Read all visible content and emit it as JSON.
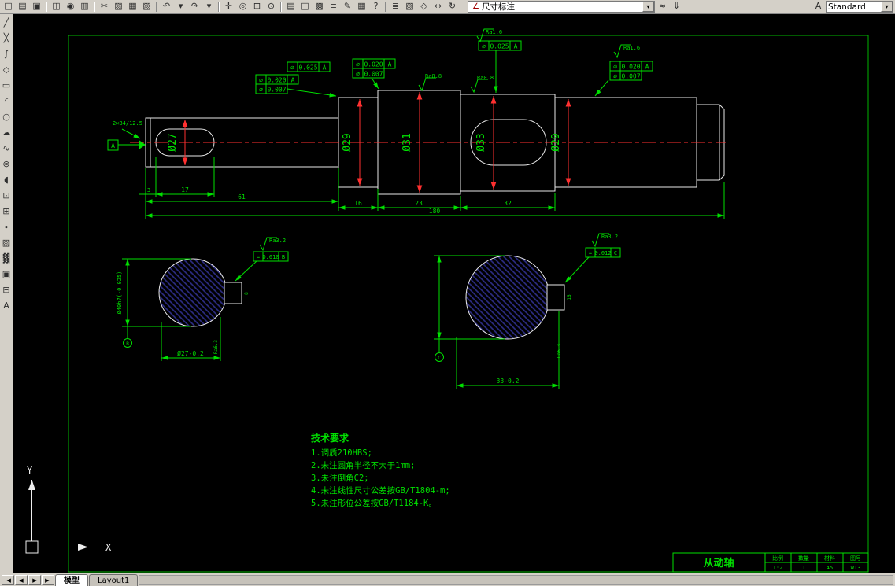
{
  "app": {
    "top_toolbar": {
      "icons": [
        {
          "name": "new-file",
          "glyph": "□"
        },
        {
          "name": "open-file",
          "glyph": "▤"
        },
        {
          "name": "save",
          "glyph": "▣"
        },
        {
          "sep": true
        },
        {
          "name": "plot",
          "glyph": "◫"
        },
        {
          "name": "plot-preview",
          "glyph": "◉"
        },
        {
          "name": "publish",
          "glyph": "▥"
        },
        {
          "sep": true
        },
        {
          "name": "cut",
          "glyph": "✂"
        },
        {
          "name": "copy",
          "glyph": "▧"
        },
        {
          "name": "paste",
          "glyph": "▦"
        },
        {
          "name": "match-properties",
          "glyph": "▨"
        },
        {
          "sep": true
        },
        {
          "name": "undo",
          "glyph": "↶"
        },
        {
          "name": "undo-dropdown",
          "glyph": "▾"
        },
        {
          "name": "redo",
          "glyph": "↷"
        },
        {
          "name": "redo-dropdown",
          "glyph": "▾"
        },
        {
          "sep": true
        },
        {
          "name": "pan",
          "glyph": "✛"
        },
        {
          "name": "zoom-realtime",
          "glyph": "◎"
        },
        {
          "name": "zoom-window",
          "glyph": "⊡"
        },
        {
          "name": "zoom-previous",
          "glyph": "⊙"
        },
        {
          "sep": true
        },
        {
          "name": "properties",
          "glyph": "▤"
        },
        {
          "name": "designcenter",
          "glyph": "◫"
        },
        {
          "name": "tool-palettes",
          "glyph": "▩"
        },
        {
          "name": "sheet-set-manager",
          "glyph": "≡"
        },
        {
          "name": "markup-set-manager",
          "glyph": "✎"
        },
        {
          "name": "quickcalc",
          "glyph": "▦"
        },
        {
          "name": "help",
          "glyph": "?"
        },
        {
          "sep": true
        },
        {
          "name": "layer-properties",
          "glyph": "≣"
        },
        {
          "name": "layer-control",
          "glyph": "▧"
        },
        {
          "name": "object-snap",
          "glyph": "◇"
        },
        {
          "name": "distance",
          "glyph": "↔"
        },
        {
          "name": "redraw",
          "glyph": "↻"
        }
      ],
      "dim_combo_icon": "∠",
      "dim_combo_value": "尺寸标注",
      "extra_icons": [
        {
          "name": "dim-update",
          "glyph": "≈"
        },
        {
          "name": "dim-reassociate",
          "glyph": "⇓"
        }
      ],
      "text_style_icon": "A",
      "style_combo_value": "Standard",
      "dropdown_glyph": "▾"
    },
    "left_toolbar": {
      "icons": [
        {
          "name": "line",
          "glyph": "╱"
        },
        {
          "name": "construction-line",
          "glyph": "╳"
        },
        {
          "name": "polyline",
          "glyph": "∫"
        },
        {
          "name": "polygon",
          "glyph": "◇"
        },
        {
          "name": "rectangle",
          "glyph": "▭"
        },
        {
          "name": "arc",
          "glyph": "◜"
        },
        {
          "name": "circle",
          "glyph": "○"
        },
        {
          "name": "revision-cloud",
          "glyph": "☁"
        },
        {
          "name": "spline",
          "glyph": "∿"
        },
        {
          "name": "ellipse",
          "glyph": "⊜"
        },
        {
          "name": "ellipse-arc",
          "glyph": "◖"
        },
        {
          "name": "insert-block",
          "glyph": "⊡"
        },
        {
          "name": "make-block",
          "glyph": "⊞"
        },
        {
          "name": "point",
          "glyph": "∙"
        },
        {
          "name": "hatch",
          "glyph": "▨"
        },
        {
          "name": "gradient",
          "glyph": "▓"
        },
        {
          "name": "region",
          "glyph": "▣"
        },
        {
          "name": "table",
          "glyph": "⊟"
        },
        {
          "name": "multiline-text",
          "glyph": "A"
        }
      ]
    },
    "tab_bar": {
      "nav": [
        "|◀",
        "◀",
        "▶",
        "▶|"
      ],
      "tabs": [
        {
          "label": "模型",
          "active": true
        },
        {
          "label": "Layout1",
          "active": false
        }
      ]
    }
  },
  "drawing": {
    "diameters": {
      "d1": "Ø27",
      "d2": "Ø29",
      "d3": "Ø31",
      "d4": "Ø33",
      "d5": "Ø29"
    },
    "lengths": {
      "l1": "3",
      "l2": "17",
      "l3": "61",
      "l4": "16",
      "l5": "23",
      "l6": "32",
      "l7": "180"
    },
    "center_hole_note": "2×B4/12.5",
    "datums": {
      "a": "A",
      "b": "B",
      "c": "C"
    },
    "roughness": {
      "r1": "Ra0.8",
      "r2": "Ra0.8",
      "r3": "Ra1.6",
      "r4": "Ra1.6",
      "r5": "Ra3.2",
      "r6": "Ra3.2",
      "r7": "Ra6.3",
      "r8": "Ra6.3"
    },
    "frames": {
      "f1": [
        "⌀",
        "0.025",
        "A"
      ],
      "f2": [
        "⌀",
        "0.020",
        "A"
      ],
      "f3": [
        "⌀",
        "0.007"
      ],
      "f4": [
        "⌀",
        "0.020",
        "A"
      ],
      "f5": [
        "⌀",
        "0.007"
      ],
      "f6": [
        "⌀",
        "0.025",
        "A"
      ],
      "f7": [
        "⌀",
        "0.020",
        "A"
      ],
      "f8": [
        "⌀",
        "0.007"
      ],
      "f9": [
        "=",
        "0.010",
        "B"
      ],
      "f10": [
        "=",
        "0.012",
        "C"
      ]
    },
    "left_section": {
      "dia": "Ø40h7(-0.025)",
      "width": "Ø27-0.2",
      "key": "8"
    },
    "right_section": {
      "width": "33-0.2",
      "key": "16"
    },
    "tech": {
      "title": "技术要求",
      "lines": [
        "1.调质210HBS;",
        "2.未注圆角半径不大于1mm;",
        "3.未注倒角C2;",
        "4.未注线性尺寸公差按GB/T1804-m;",
        "5.未注形位公差按GB/T1184-K。"
      ]
    },
    "title_block": {
      "part": "从动轴",
      "headers": [
        "比例",
        "数量",
        "材料",
        "图号"
      ],
      "values": [
        "1:2",
        "1",
        "45",
        "W13"
      ]
    }
  }
}
